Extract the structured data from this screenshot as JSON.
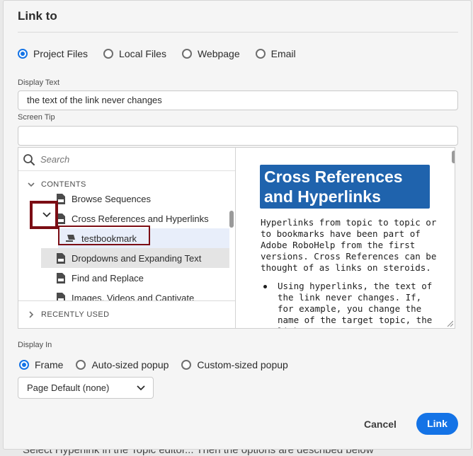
{
  "background": {
    "text": "Select Hyperlink in the Topic editor... Then the options are described below"
  },
  "dialog": {
    "title": "Link to"
  },
  "link_type": {
    "options": [
      "Project Files",
      "Local Files",
      "Webpage",
      "Email"
    ],
    "selected": "Project Files"
  },
  "display_text": {
    "label": "Display Text",
    "value": "the text of the link never changes"
  },
  "screen_tip": {
    "label": "Screen Tip",
    "value": ""
  },
  "tree": {
    "search_placeholder": "Search",
    "contents_header": "CONTENTS",
    "recently_used_header": "RECENTLY USED",
    "items": [
      {
        "label": "Browse Sequences"
      },
      {
        "label": "Cross References and Hyperlinks"
      },
      {
        "label": "testbookmark"
      },
      {
        "label": "Dropdowns and Expanding Text"
      },
      {
        "label": "Find and Replace"
      },
      {
        "label": "Images, Videos and Captivate"
      }
    ]
  },
  "preview": {
    "title": "Cross References and Hyperlinks",
    "paragraph": "Hyperlinks from topic to topic or to bookmarks have been part of Adobe RoboHelp from the first versions. Cross References can be thought of as links on steroids.",
    "bullet": "Using hyperlinks, the text of the link never changes. If, for example, you change the name of the target topic, the link"
  },
  "display_in": {
    "label": "Display In",
    "options": [
      "Frame",
      "Auto-sized popup",
      "Custom-sized popup"
    ],
    "selected": "Frame",
    "dropdown_value": "Page Default (none)"
  },
  "buttons": {
    "cancel": "Cancel",
    "link": "Link"
  },
  "colors": {
    "accent": "#1473e6",
    "annotation": "#7b0d14",
    "preview_title_bg": "#1f63ad"
  }
}
